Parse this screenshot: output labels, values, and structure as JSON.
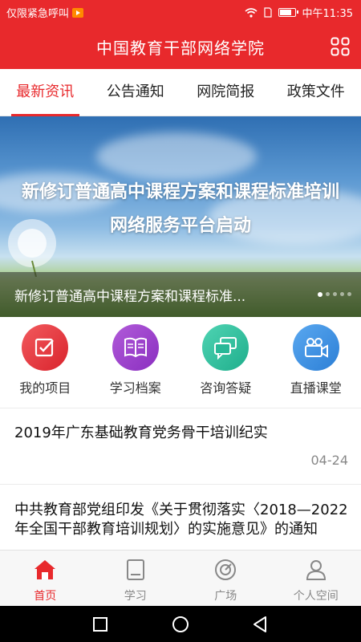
{
  "status_bar": {
    "left_text": "仅限紧急呼叫",
    "time": "中午11:35"
  },
  "header": {
    "title": "中国教育干部网络学院",
    "menu_icon": "grid-icon"
  },
  "tabs": [
    {
      "label": "最新资讯",
      "active": true
    },
    {
      "label": "公告通知",
      "active": false
    },
    {
      "label": "网院简报",
      "active": false
    },
    {
      "label": "政策文件",
      "active": false
    }
  ],
  "banner": {
    "headline_line1": "新修订普通高中课程方案和课程标准培训",
    "headline_line2": "网络服务平台启动",
    "caption": "新修订普通高中课程方案和课程标准...",
    "slide_count": 5,
    "active_slide": 1
  },
  "quick_actions": [
    {
      "label": "我的项目",
      "icon": "checklist-icon",
      "color": "#e8363f"
    },
    {
      "label": "学习档案",
      "icon": "book-icon",
      "color": "#9b3fc8"
    },
    {
      "label": "咨询答疑",
      "icon": "chat-icon",
      "color": "#2ebfa0"
    },
    {
      "label": "直播课堂",
      "icon": "video-camera-icon",
      "color": "#3c8fe0"
    }
  ],
  "news": [
    {
      "title": "2019年广东基础教育党务骨干培训纪实",
      "date": "04-24"
    },
    {
      "title": "中共教育部党组印发《关于贯彻落实〈2018—2022年全国干部教育培训规划〉的实施意见》的通知",
      "date": ""
    }
  ],
  "bottom_nav": [
    {
      "label": "首页",
      "icon": "home-icon",
      "active": true
    },
    {
      "label": "学习",
      "icon": "study-icon",
      "active": false
    },
    {
      "label": "广场",
      "icon": "compass-icon",
      "active": false
    },
    {
      "label": "个人空间",
      "icon": "person-icon",
      "active": false
    }
  ],
  "colors": {
    "brand_red": "#e8292c"
  }
}
